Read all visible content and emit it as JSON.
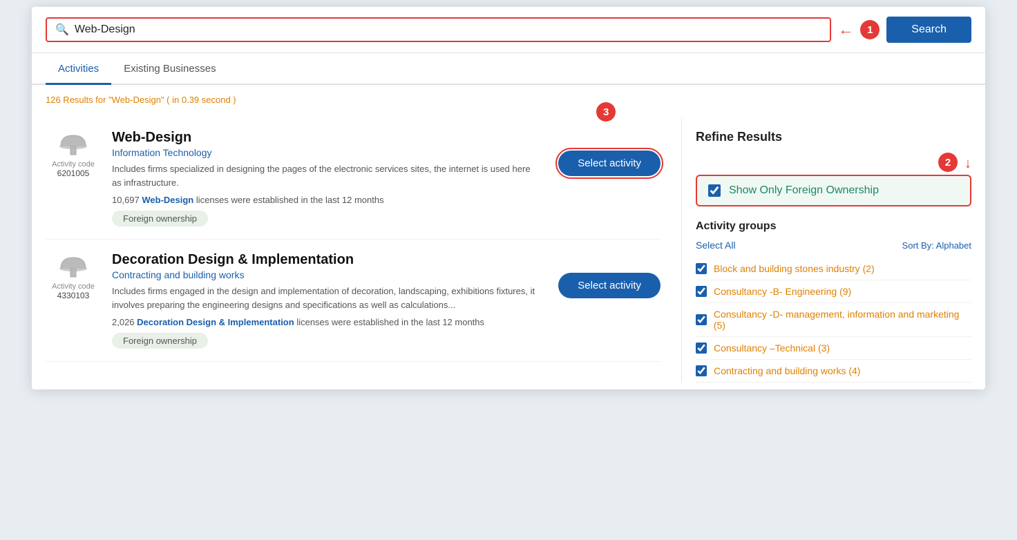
{
  "search": {
    "placeholder": "Web-Design",
    "value": "Web-Design",
    "button_label": "Search",
    "icon": "🔍"
  },
  "tabs": [
    {
      "label": "Activities",
      "active": true
    },
    {
      "label": "Existing Businesses",
      "active": false
    }
  ],
  "results_count": {
    "text": "126 Results for \"Web-Design\" ( in 0.39 second )"
  },
  "results": [
    {
      "icon": "dome",
      "activity_code_label": "Activity code",
      "activity_code_number": "6201005",
      "title": "Web-Design",
      "category": "Information Technology",
      "description": "Includes firms specialized in designing the pages of the electronic services sites, the internet is used here as infrastructure.",
      "licenses_text": "10,697 ",
      "licenses_bold": "Web-Design",
      "licenses_suffix": " licenses were established in the last 12 months",
      "badge": "Foreign ownership",
      "select_label": "Select activity"
    },
    {
      "icon": "dome",
      "activity_code_label": "Activity code",
      "activity_code_number": "4330103",
      "title": "Decoration Design & Implementation",
      "category": "Contracting and building works",
      "description": "Includes firms engaged in the design and implementation of decoration, landscaping, exhibitions fixtures, it involves preparing the engineering designs and specifications as well as calculations...",
      "licenses_text": "2,026 ",
      "licenses_bold": "Decoration Design & Implementation",
      "licenses_suffix": " licenses were established in the last 12 months",
      "badge": "Foreign ownership",
      "select_label": "Select activity"
    }
  ],
  "right_panel": {
    "refine_title": "Refine Results",
    "show_foreign_label": "Show Only Foreign Ownership",
    "activity_groups_title": "Activity groups",
    "select_all_label": "Select All",
    "sort_by_label": "Sort By: Alphabet",
    "groups": [
      {
        "label": "Block and building stones industry",
        "count": "(2)"
      },
      {
        "label": "Consultancy -B- Engineering",
        "count": "(9)"
      },
      {
        "label": "Consultancy -D- management, information and marketing",
        "count": "(5)"
      },
      {
        "label": "Consultancy –Technical",
        "count": "(3)"
      },
      {
        "label": "Contracting and building works",
        "count": "(4)"
      }
    ]
  },
  "annotations": {
    "badge1_label": "1",
    "badge2_label": "2",
    "badge3_label": "3"
  }
}
